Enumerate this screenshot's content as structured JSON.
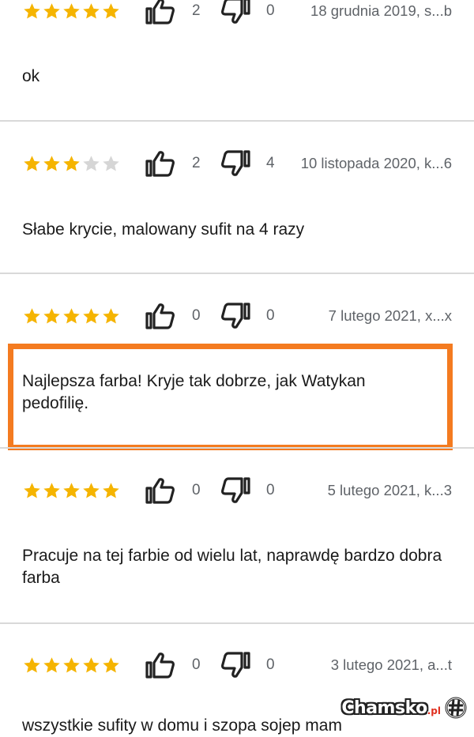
{
  "colors": {
    "star_filled": "#f5b400",
    "star_empty": "#d6d6d6",
    "highlight": "#f47b20",
    "meta_text": "#5f6368",
    "divider": "#d9d9d9"
  },
  "reviews": [
    {
      "rating": 5,
      "thumbs_up": "2",
      "thumbs_down": "0",
      "date": "18 grudnia 2019, s...b",
      "text": "ok"
    },
    {
      "rating": 3,
      "thumbs_up": "2",
      "thumbs_down": "4",
      "date": "10 listopada 2020, k...6",
      "text": "Słabe krycie, malowany sufit na 4 razy"
    },
    {
      "rating": 5,
      "thumbs_up": "0",
      "thumbs_down": "0",
      "date": "7 lutego 2021, x...x",
      "text": "Najlepsza farba! Kryje tak dobrze, jak Watykan pedofilię."
    },
    {
      "rating": 5,
      "thumbs_up": "0",
      "thumbs_down": "0",
      "date": "5 lutego 2021, k...3",
      "text": "Pracuje na tej farbie od wielu lat, naprawdę bardzo dobra farba"
    },
    {
      "rating": 5,
      "thumbs_up": "0",
      "thumbs_down": "0",
      "date": "3 lutego 2021, a...t",
      "text": "wszystkie sufity w domu i szopa sojep mam"
    }
  ],
  "watermark": {
    "name": "Chamsko",
    "tld": ".pl"
  }
}
